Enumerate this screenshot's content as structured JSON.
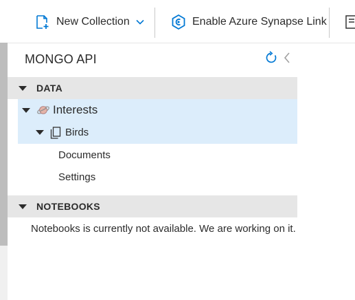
{
  "toolbar": {
    "new_collection_label": "New Collection",
    "enable_synapse_label": "Enable Azure Synapse Link"
  },
  "panel": {
    "title": "MONGO API"
  },
  "tree": {
    "data_section_label": "DATA",
    "database": {
      "name": "Interests",
      "collection": {
        "name": "Birds",
        "children": [
          "Documents",
          "Settings"
        ]
      }
    },
    "notebooks_section_label": "NOTEBOOKS",
    "notebooks_message": "Notebooks is currently not available. We are working on it."
  },
  "colors": {
    "accent": "#0078d4",
    "selected_row": "#dcedfb",
    "section_header": "#e6e6e6"
  },
  "icons": [
    "new-collection-icon",
    "chevron-down-icon",
    "synapse-link-icon",
    "refresh-icon",
    "collapse-icon",
    "database-icon",
    "collection-icon"
  ]
}
